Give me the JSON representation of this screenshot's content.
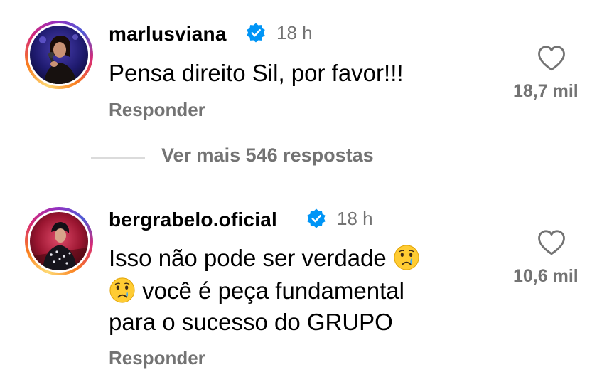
{
  "comments": [
    {
      "username": "marlusviana",
      "time": "18 h",
      "lines": [
        "Pensa direito Sil, por favor!!!"
      ],
      "reply_label": "Responder",
      "likes": "18,7 mil",
      "verified": true,
      "avatar": "man-singing-with-microphone"
    },
    {
      "username": "bergrabelo.oficial",
      "time": "18 h",
      "lines": [
        "Isso não pode ser verdade",
        "você é peça fundamental",
        "para o sucesso do GRUPO"
      ],
      "reply_label": "Responder",
      "likes": "10,6 mil",
      "verified": true,
      "avatar": "performer-on-stage",
      "emoji": "crying-face"
    }
  ],
  "view_more": "Ver mais 546 respostas",
  "colors": {
    "text": "#000000",
    "secondary": "#737373",
    "verified_badge": "#0095f6",
    "divider": "#dbdbdb"
  },
  "icons": {
    "verified": "verified-badge-icon",
    "like": "heart-icon",
    "emoji": "crying-face-emoji"
  }
}
